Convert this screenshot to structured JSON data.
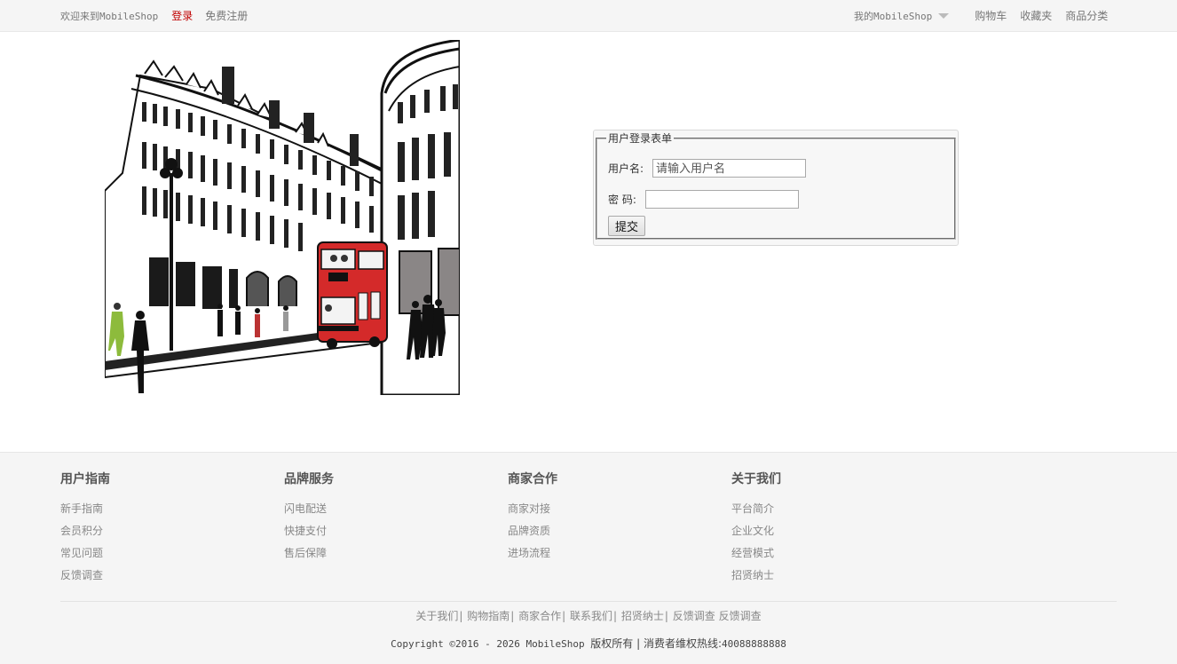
{
  "topbar": {
    "welcome": "欢迎来到MobileShop",
    "login": "登录",
    "register": "免费注册",
    "my_shop": "我的MobileShop",
    "cart": "购物车",
    "favorites": "收藏夹",
    "categories": "商品分类"
  },
  "login_form": {
    "legend": "用户登录表单",
    "username_label": "用户名:",
    "username_placeholder": "请输入用户名",
    "username_value": "",
    "password_label": "密 码:",
    "password_value": "",
    "submit_label": "提交"
  },
  "footer": {
    "columns": [
      {
        "title": "用户指南",
        "items": [
          "新手指南",
          "会员积分",
          "常见问题",
          "反馈调查"
        ]
      },
      {
        "title": "品牌服务",
        "items": [
          "闪电配送",
          "快捷支付",
          "售后保障"
        ]
      },
      {
        "title": "商家合作",
        "items": [
          "商家对接",
          "品牌资质",
          "进场流程"
        ]
      },
      {
        "title": "关于我们",
        "items": [
          "平台简介",
          "企业文化",
          "经营模式",
          "招贤纳士"
        ]
      }
    ],
    "bottom_links": [
      "关于我们",
      "购物指南",
      "商家合作",
      "联系我们",
      "招贤纳士",
      "反馈调查",
      "反馈调查"
    ],
    "copyright_prefix": "Copyright ©2016 - 2026 MobileShop ",
    "copyright_rights": "版权所有 | 消费者维权热线:",
    "hotline": "40088888888"
  },
  "colors": {
    "accent": "#c00000",
    "bus": "#d42a2a"
  }
}
